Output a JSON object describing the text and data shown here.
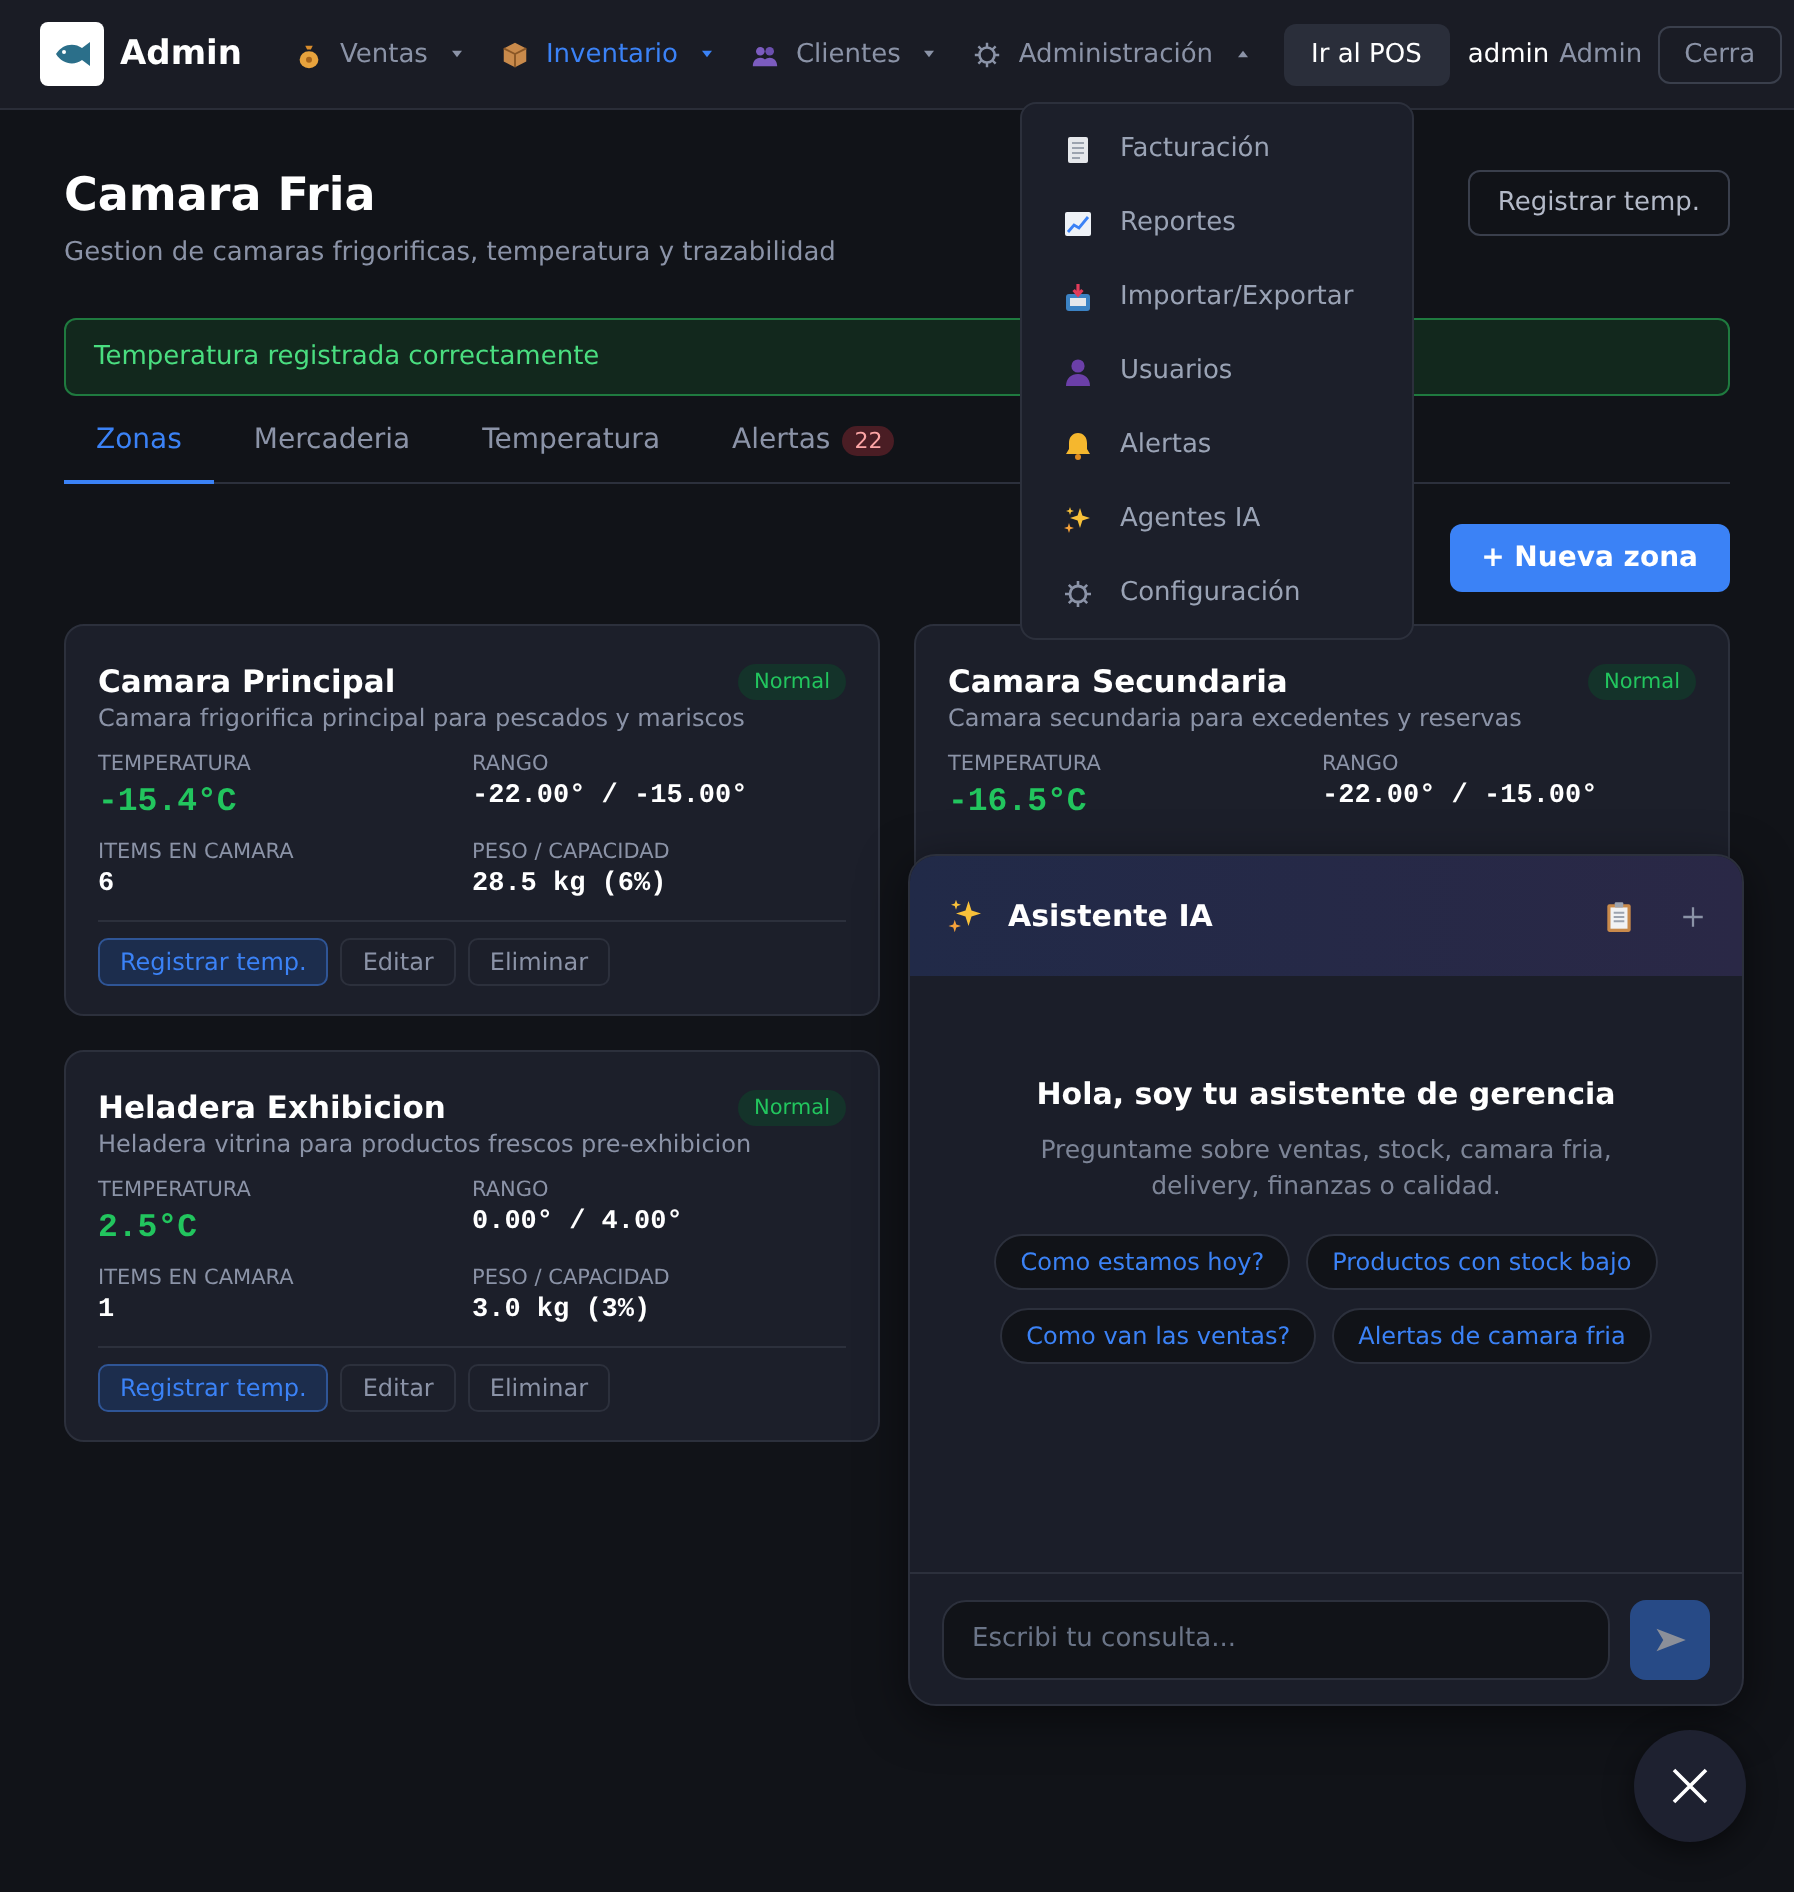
{
  "header": {
    "brand": "Admin",
    "nav": [
      {
        "label": "Ventas",
        "selected": false,
        "expanded": false
      },
      {
        "label": "Inventario",
        "selected": true,
        "expanded": false
      },
      {
        "label": "Clientes",
        "selected": false,
        "expanded": false
      },
      {
        "label": "Administración",
        "selected": false,
        "expanded": true
      }
    ],
    "pos_button": "Ir al POS",
    "user": {
      "name": "admin",
      "role": "Admin"
    },
    "logout_button": "Cerra"
  },
  "page": {
    "title": "Camara Fria",
    "subtitle": "Gestion de camaras frigorificas, temperatura y trazabilidad",
    "register_button": "Registrar temp."
  },
  "alert": {
    "message": "Temperatura registrada correctamente"
  },
  "tabs": [
    {
      "label": "Zonas",
      "selected": true
    },
    {
      "label": "Mercaderia",
      "selected": false
    },
    {
      "label": "Temperatura",
      "selected": false
    },
    {
      "label": "Alertas",
      "selected": false,
      "badge": "22"
    }
  ],
  "new_zone_button": "+ Nueva zona",
  "zones": [
    {
      "name": "Camara Principal",
      "status": "Normal",
      "description": "Camara frigorifica principal para pescados y mariscos",
      "fields": [
        {
          "label": "TEMPERATURA",
          "value": "-15.4°C",
          "kind": "temperature"
        },
        {
          "label": "RANGO",
          "value": "-22.00° / -15.00°",
          "kind": "plain"
        },
        {
          "label": "ITEMS EN CAMARA",
          "value": "6",
          "kind": "plain"
        },
        {
          "label": "PESO / CAPACIDAD",
          "value": "28.5 kg (6%)",
          "kind": "plain"
        }
      ],
      "actions": [
        {
          "label": "Registrar temp.",
          "kind": "primary"
        },
        {
          "label": "Editar",
          "kind": "secondary"
        },
        {
          "label": "Eliminar",
          "kind": "secondary"
        }
      ]
    },
    {
      "name": "Camara Secundaria",
      "status": "Normal",
      "description": "Camara secundaria para excedentes y reservas",
      "fields": [
        {
          "label": "TEMPERATURA",
          "value": "-16.5°C",
          "kind": "temperature"
        },
        {
          "label": "RANGO",
          "value": "-22.00° / -15.00°",
          "kind": "plain"
        }
      ]
    },
    {
      "name": "Heladera Exhibicion",
      "status": "Normal",
      "description": "Heladera vitrina para productos frescos pre-exhibicion",
      "fields": [
        {
          "label": "TEMPERATURA",
          "value": "2.5°C",
          "kind": "temperature"
        },
        {
          "label": "RANGO",
          "value": "0.00° / 4.00°",
          "kind": "plain"
        },
        {
          "label": "ITEMS EN CAMARA",
          "value": "1",
          "kind": "plain"
        },
        {
          "label": "PESO / CAPACIDAD",
          "value": "3.0 kg (3%)",
          "kind": "plain"
        }
      ],
      "actions": [
        {
          "label": "Registrar temp.",
          "kind": "primary"
        },
        {
          "label": "Editar",
          "kind": "secondary"
        },
        {
          "label": "Eliminar",
          "kind": "secondary"
        }
      ]
    }
  ],
  "admin_menu": {
    "items": [
      {
        "label": "Facturación"
      },
      {
        "label": "Reportes"
      },
      {
        "label": "Importar/Exportar"
      },
      {
        "label": "Usuarios"
      },
      {
        "label": "Alertas"
      },
      {
        "label": "Agentes IA"
      },
      {
        "label": "Configuración"
      }
    ]
  },
  "chat": {
    "title": "Asistente IA",
    "greeting": "Hola, soy tu asistente de gerencia",
    "intro": "Preguntame sobre ventas, stock, camara fria, delivery, finanzas o calidad.",
    "suggestions": [
      "Como estamos hoy?",
      "Productos con stock bajo",
      "Como van las ventas?",
      "Alertas de camara fria"
    ],
    "input": {
      "placeholder": "Escribi tu consulta..."
    }
  }
}
